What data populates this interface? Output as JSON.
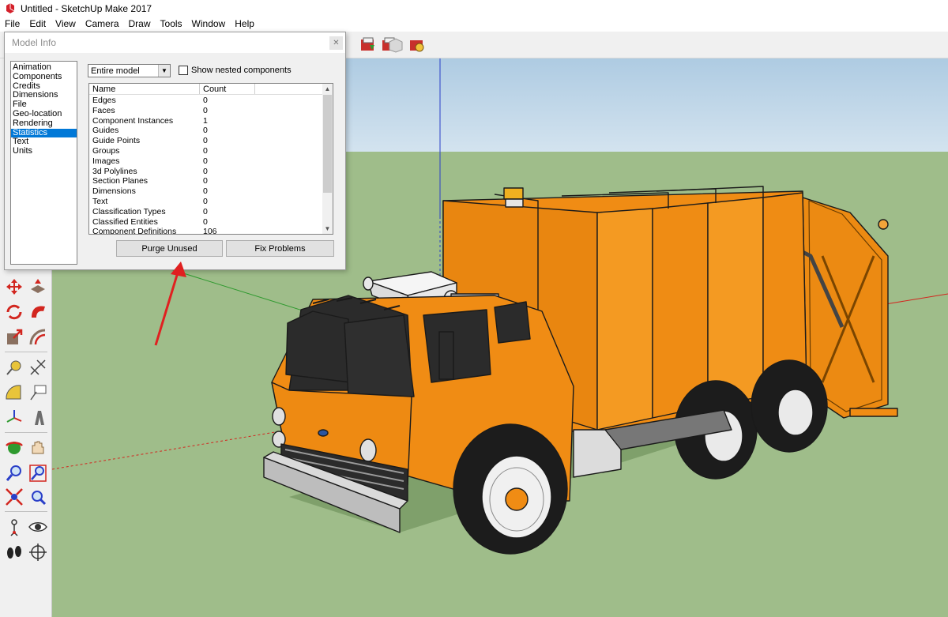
{
  "app": {
    "title": "Untitled - SketchUp Make 2017",
    "icon": "sketchup-logo-icon"
  },
  "menu": [
    "File",
    "Edit",
    "View",
    "Camera",
    "Draw",
    "Tools",
    "Window",
    "Help"
  ],
  "toolbar": {
    "icons": [
      "get-models-icon",
      "share-model-icon",
      "extension-warehouse-icon",
      "extension-manager-icon"
    ]
  },
  "left_toolbar": {
    "icons": [
      "move-icon",
      "push-pull-icon",
      "rotate-icon",
      "follow-me-icon",
      "scale-icon",
      "offset-icon",
      "tape-measure-icon",
      "dimension-icon",
      "protractor-icon",
      "text-icon",
      "axes-icon",
      "3d-text-icon",
      "orbit-icon",
      "pan-icon",
      "zoom-icon",
      "zoom-window-icon",
      "zoom-extents-icon",
      "previous-view-icon",
      "position-camera-icon",
      "look-around-icon",
      "walk-icon",
      "section-plane-icon"
    ]
  },
  "dialog": {
    "title": "Model Info",
    "close_icon": "close-icon",
    "nav_items": [
      "Animation",
      "Components",
      "Credits",
      "Dimensions",
      "File",
      "Geo-location",
      "Rendering",
      "Statistics",
      "Text",
      "Units"
    ],
    "selected_nav": "Statistics",
    "scope_value": "Entire model",
    "show_nested_label": "Show nested components",
    "show_nested_checked": false,
    "columns": {
      "name": "Name",
      "count": "Count"
    },
    "rows": [
      {
        "name": "Edges",
        "count": "0"
      },
      {
        "name": "Faces",
        "count": "0"
      },
      {
        "name": "Component Instances",
        "count": "1"
      },
      {
        "name": "Guides",
        "count": "0"
      },
      {
        "name": "Guide Points",
        "count": "0"
      },
      {
        "name": "Groups",
        "count": "0"
      },
      {
        "name": "Images",
        "count": "0"
      },
      {
        "name": "3d Polylines",
        "count": "0"
      },
      {
        "name": "Section Planes",
        "count": "0"
      },
      {
        "name": "Dimensions",
        "count": "0"
      },
      {
        "name": "Text",
        "count": "0"
      },
      {
        "name": "Classification Types",
        "count": "0"
      },
      {
        "name": "Classified Entities",
        "count": "0"
      },
      {
        "name": "Component Definitions",
        "count": "106"
      }
    ],
    "purge_label": "Purge Unused",
    "fix_label": "Fix Problems"
  },
  "colors": {
    "sky": "#c0d6e8",
    "ground": "#9fbd8a",
    "truck_orange": "#f08c14",
    "selection": "#0078d7",
    "annotation_arrow": "#e02020"
  }
}
